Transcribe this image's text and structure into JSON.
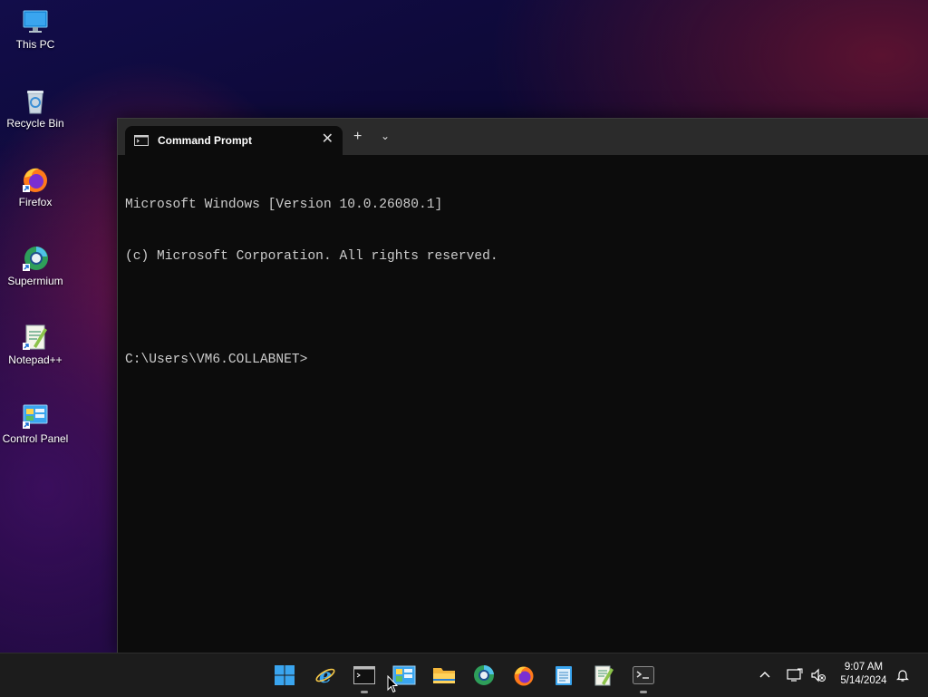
{
  "desktop": {
    "icons": [
      {
        "label": "This PC",
        "icon": "this-pc-icon"
      },
      {
        "label": "Recycle Bin",
        "icon": "recycle-bin-icon"
      },
      {
        "label": "Firefox",
        "icon": "firefox-icon"
      },
      {
        "label": "Supermium",
        "icon": "supermium-icon"
      },
      {
        "label": "Notepad++",
        "icon": "notepadpp-icon"
      },
      {
        "label": "Control Panel",
        "icon": "control-panel-icon"
      }
    ]
  },
  "terminal": {
    "tab_title": "Command Prompt",
    "close_glyph": "✕",
    "new_tab_glyph": "+",
    "dropdown_glyph": "⌄",
    "lines": [
      "Microsoft Windows [Version 10.0.26080.1]",
      "(c) Microsoft Corporation. All rights reserved.",
      "",
      "C:\\Users\\VM6.COLLABNET>"
    ]
  },
  "taskbar": {
    "apps": [
      {
        "name": "start-button",
        "icon": "windows-logo-icon"
      },
      {
        "name": "internet-explorer",
        "icon": "internet-explorer-icon"
      },
      {
        "name": "command-prompt",
        "icon": "cmd-icon"
      },
      {
        "name": "control-panel",
        "icon": "control-panel-icon"
      },
      {
        "name": "file-explorer",
        "icon": "folder-icon"
      },
      {
        "name": "supermium",
        "icon": "supermium-icon"
      },
      {
        "name": "firefox",
        "icon": "firefox-icon"
      },
      {
        "name": "notepad",
        "icon": "notepad-icon"
      },
      {
        "name": "notepadpp",
        "icon": "notepadpp-icon"
      },
      {
        "name": "terminal",
        "icon": "terminal-icon"
      }
    ],
    "time": "9:07 AM",
    "date": "5/14/2024"
  },
  "colors": {
    "terminal_bg": "#0c0c0c",
    "titlebar_bg": "#2b2b2b",
    "taskbar_bg": "#1c1c1c",
    "console_text": "#cccccc"
  }
}
